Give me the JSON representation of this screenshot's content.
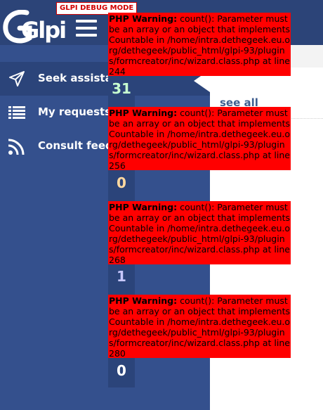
{
  "header": {
    "logo_text": "Glpi",
    "debug_mode": "GLPI DEBUG MODE"
  },
  "sidebar": {
    "items": [
      {
        "label": "Seek assistance",
        "icon": "paper-plane-icon",
        "active": true
      },
      {
        "label": "My requests",
        "icon": "list-icon",
        "active": false
      },
      {
        "label": "Consult feeds",
        "icon": "rss-icon",
        "active": false
      }
    ]
  },
  "main": {
    "see_all": "see all"
  },
  "counters": [
    {
      "value": "31",
      "color": "#c8ffd0"
    },
    {
      "value": "0",
      "color": "#ffd9a0"
    },
    {
      "value": "1",
      "color": "#c8c8ff"
    },
    {
      "value": "0",
      "color": "#ffffff"
    }
  ],
  "warnings": [
    {
      "label": "PHP Warning:",
      "message": "count(): Parameter must be an array or an object that implements Countable in /home/intra.dethegeek.eu.org/dethegeek/public_html/glpi-93/plugins/formcreator/inc/wizard.class.php at line 244"
    },
    {
      "label": "PHP Warning:",
      "message": "count(): Parameter must be an array or an object that implements Countable in /home/intra.dethegeek.eu.org/dethegeek/public_html/glpi-93/plugins/formcreator/inc/wizard.class.php at line 256"
    },
    {
      "label": "PHP Warning:",
      "message": "count(): Parameter must be an array or an object that implements Countable in /home/intra.dethegeek.eu.org/dethegeek/public_html/glpi-93/plugins/formcreator/inc/wizard.class.php at line 268"
    },
    {
      "label": "PHP Warning:",
      "message": "count(): Parameter must be an array or an object that implements Countable in /home/intra.dethegeek.eu.org/dethegeek/public_html/glpi-93/plugins/formcreator/inc/wizard.class.php at line 280"
    }
  ],
  "colors": {
    "header": "#2c4478",
    "sidebar": "#34508d",
    "active_item": "#2b447a",
    "warning": "#ff0000"
  }
}
